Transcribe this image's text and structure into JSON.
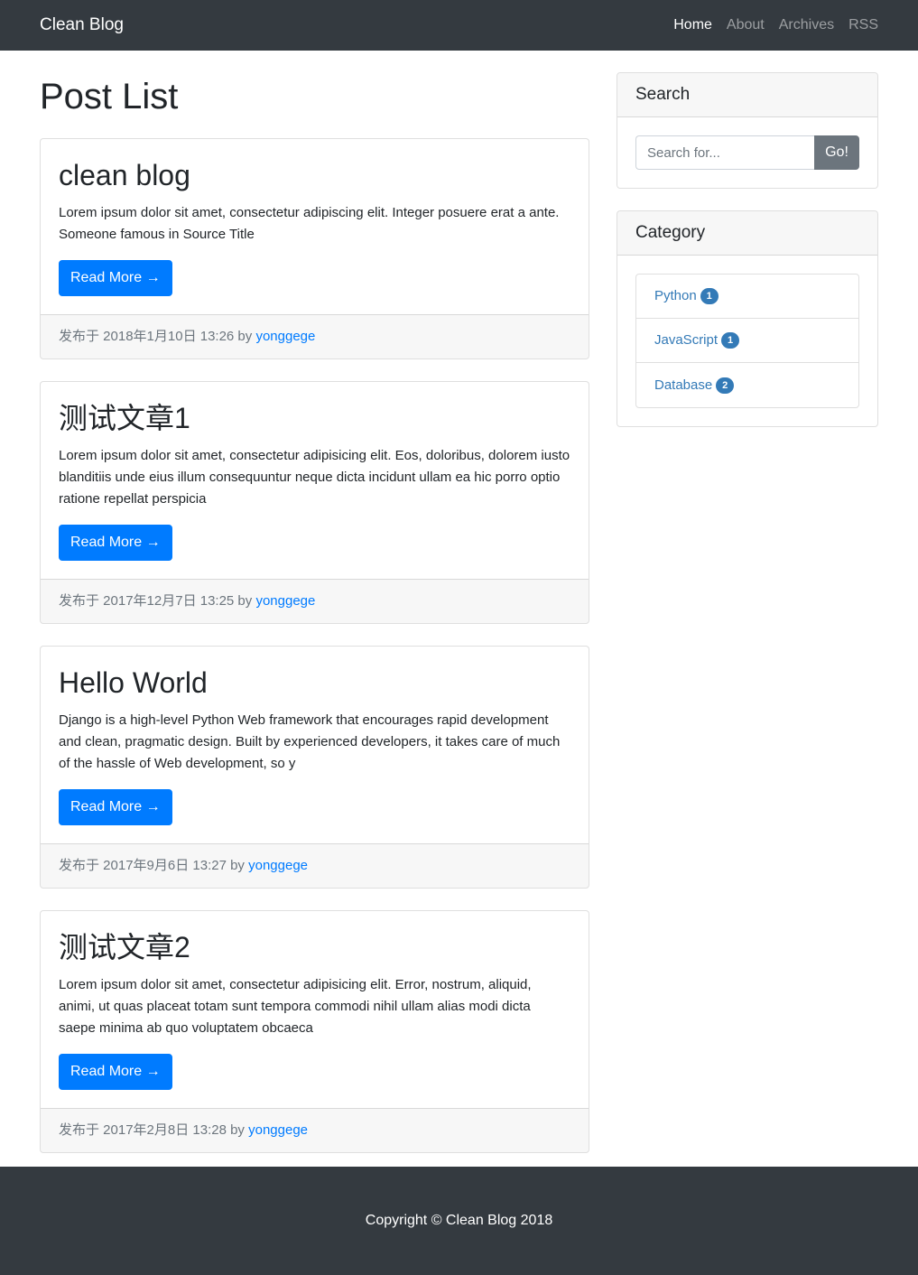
{
  "navbar": {
    "brand": "Clean Blog",
    "links": [
      {
        "label": "Home",
        "active": true
      },
      {
        "label": "About"
      },
      {
        "label": "Archives"
      },
      {
        "label": "RSS"
      }
    ]
  },
  "main": {
    "title": "Post List",
    "read_more_label": "Read More →",
    "posts": [
      {
        "title": "clean blog",
        "excerpt": "Lorem ipsum dolor sit amet, consectetur adipiscing elit. Integer posuere erat a ante. Someone famous in Source Title",
        "meta": "发布于 2018年1月10日 13:26 by ",
        "author": "yonggege"
      },
      {
        "title": "测试文章1",
        "excerpt": "Lorem ipsum dolor sit amet, consectetur adipisicing elit. Eos, doloribus, dolorem iusto blanditiis unde eius illum consequuntur neque dicta incidunt ullam ea hic porro optio ratione repellat perspicia",
        "meta": "发布于 2017年12月7日 13:25 by ",
        "author": "yonggege"
      },
      {
        "title": "Hello World",
        "excerpt": "Django is a high-level Python Web framework that encourages rapid development and clean, pragmatic design. Built by experienced developers, it takes care of much of the hassle of Web development, so y",
        "meta": "发布于 2017年9月6日 13:27 by ",
        "author": "yonggege"
      },
      {
        "title": "测试文章2",
        "excerpt": "Lorem ipsum dolor sit amet, consectetur adipisicing elit. Error, nostrum, aliquid, animi, ut quas placeat totam sunt tempora commodi nihil ullam alias modi dicta saepe minima ab quo voluptatem obcaeca",
        "meta": "发布于 2017年2月8日 13:28 by ",
        "author": "yonggege"
      }
    ]
  },
  "sidebar": {
    "search": {
      "title": "Search",
      "placeholder": "Search for...",
      "button": "Go!"
    },
    "category": {
      "title": "Category",
      "items": [
        {
          "name": "Python",
          "count": "1"
        },
        {
          "name": "JavaScript",
          "count": "1"
        },
        {
          "name": "Database",
          "count": "2"
        }
      ]
    }
  },
  "footer": {
    "copyright": "Copyright © Clean Blog 2018"
  },
  "colors": {
    "navbar_bg": "#343a40",
    "primary": "#007bff",
    "secondary": "#6c757d",
    "link": "#337ab7"
  }
}
